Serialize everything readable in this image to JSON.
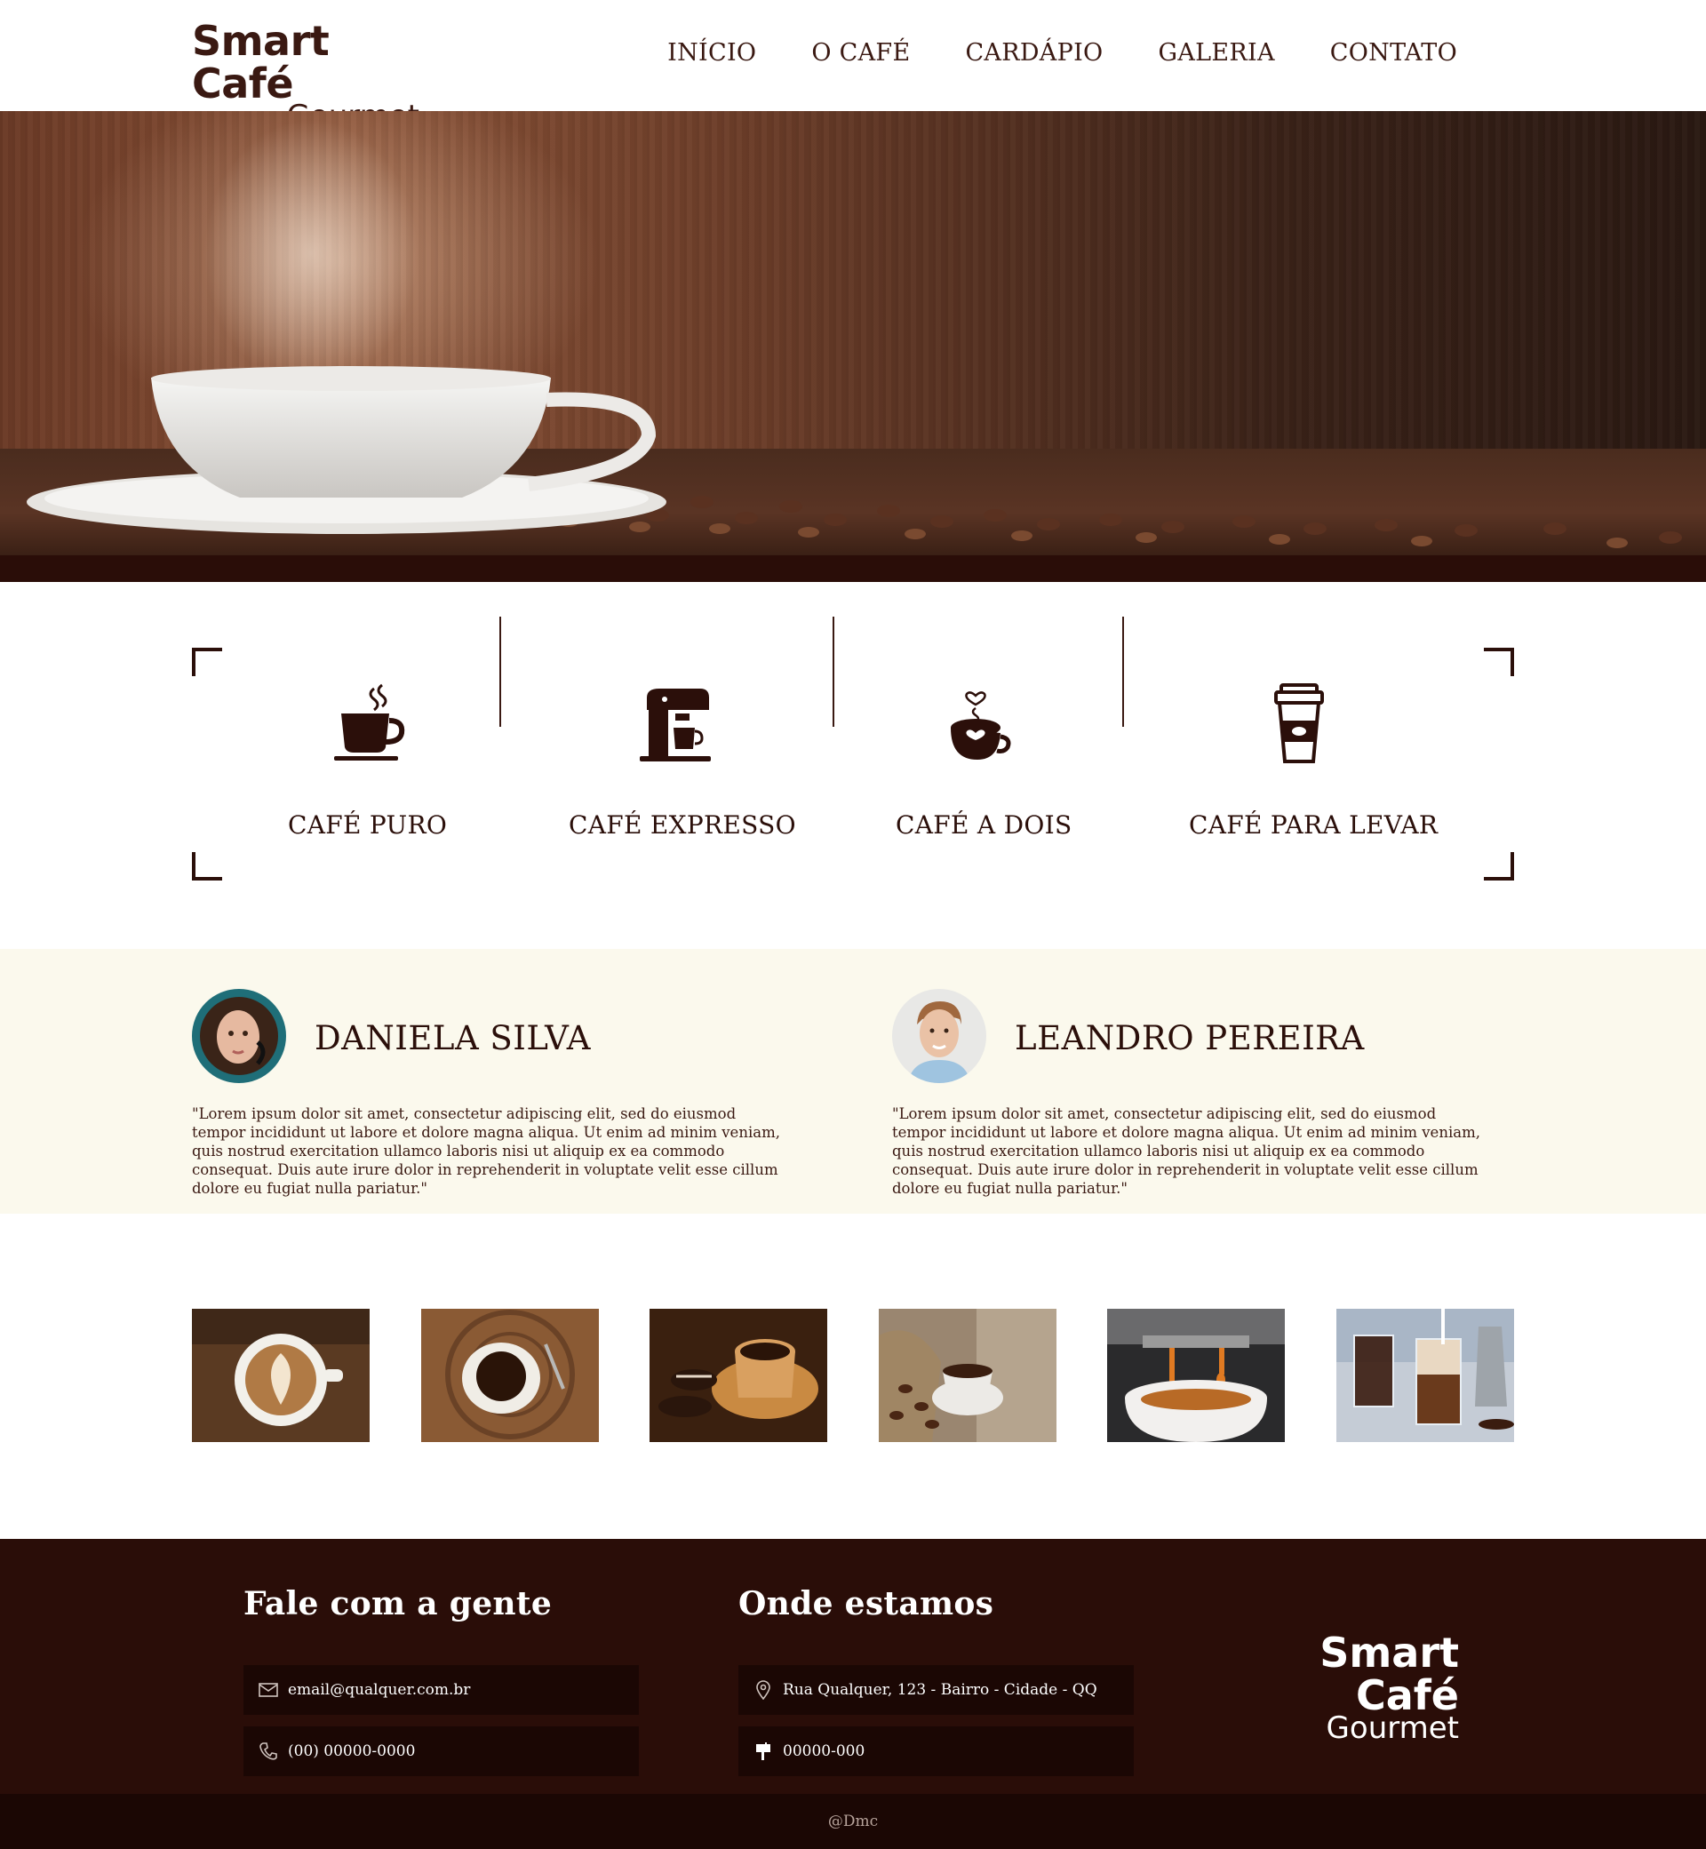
{
  "brand": {
    "line1": "Smart Café",
    "line2": "Gourmet"
  },
  "nav": [
    {
      "label": "INÍCIO"
    },
    {
      "label": "O CAFÉ"
    },
    {
      "label": "CARDÁPIO"
    },
    {
      "label": "GALERIA"
    },
    {
      "label": "CONTATO"
    }
  ],
  "features": [
    {
      "label": "CAFÉ PURO",
      "icon": "coffee-cup-steam-icon"
    },
    {
      "label": "CAFÉ EXPRESSO",
      "icon": "espresso-machine-icon"
    },
    {
      "label": "CAFÉ A DOIS",
      "icon": "heart-coffee-cup-icon"
    },
    {
      "label": "CAFÉ PARA LEVAR",
      "icon": "takeaway-cup-icon"
    }
  ],
  "testimonials": [
    {
      "name": "DANIELA SILVA",
      "quote": "\"Lorem ipsum dolor sit amet, consectetur adipiscing elit, sed do eiusmod tempor incididunt ut labore et dolore magna aliqua. Ut enim ad minim veniam, quis nostrud exercitation ullamco laboris nisi ut aliquip ex ea commodo consequat. Duis aute irure dolor in reprehenderit in voluptate velit esse cillum dolore eu fugiat nulla pariatur.\""
    },
    {
      "name": "LEANDRO PEREIRA",
      "quote": "\"Lorem ipsum dolor sit amet, consectetur adipiscing elit, sed do eiusmod tempor incididunt ut labore et dolore magna aliqua. Ut enim ad minim veniam, quis nostrud exercitation ullamco laboris nisi ut aliquip ex ea commodo consequat. Duis aute irure dolor in reprehenderit in voluptate velit esse cillum dolore eu fugiat nulla pariatur.\""
    }
  ],
  "gallery": [
    {
      "name": "latte-art"
    },
    {
      "name": "black-coffee-wood"
    },
    {
      "name": "coffee-chocolates"
    },
    {
      "name": "coffee-beans-sack"
    },
    {
      "name": "espresso-pour"
    },
    {
      "name": "iced-coffee"
    }
  ],
  "footer": {
    "contact_title": "Fale com a gente",
    "email": "email@qualquer.com.br",
    "phone": "(00) 00000-0000",
    "location_title": "Onde estamos",
    "address": "Rua Qualquer, 123 - Bairro - Cidade - QQ",
    "zip": "00000-000",
    "credit": "@Dmc"
  },
  "colors": {
    "primary": "#2b0f0a",
    "footer_bg": "#2a0d08",
    "footer_box": "#1b0704",
    "testimonial_bg": "#fbf9ed"
  }
}
